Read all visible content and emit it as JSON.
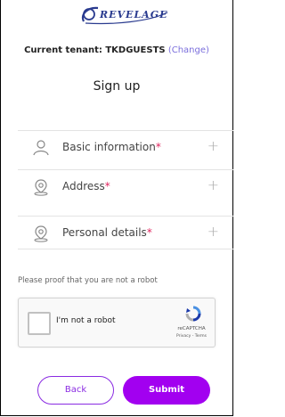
{
  "brand": {
    "logo_text": "REVELAGE"
  },
  "tenant": {
    "label": "Current tenant: TKDGUESTS",
    "change_link": "Change"
  },
  "page": {
    "title": "Sign up"
  },
  "sections": [
    {
      "label": "Basic information",
      "icon": "person-icon",
      "required_mark": "*",
      "expand": "+"
    },
    {
      "label": "Address",
      "icon": "map-pin-icon",
      "required_mark": "*",
      "expand": "+"
    },
    {
      "label": "Personal details",
      "icon": "map-pin-icon",
      "required_mark": "*",
      "expand": "+"
    }
  ],
  "captcha": {
    "prompt": "Please proof that you are not a robot",
    "checkbox_label": "I'm not a robot",
    "brand": "reCAPTCHA",
    "links": "Privacy - Terms"
  },
  "actions": {
    "back_label": "Back",
    "submit_label": "Submit"
  },
  "colors": {
    "accent": "#a200f0",
    "required": "#e0245e",
    "link": "#7b6fdc"
  }
}
